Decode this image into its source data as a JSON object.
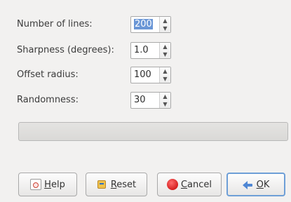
{
  "fields": [
    {
      "label": "Number of lines:",
      "value": "200",
      "selected": true
    },
    {
      "label": "Sharpness (degrees):",
      "value": "1.0",
      "selected": false
    },
    {
      "label": "Offset radius:",
      "value": "100",
      "selected": false
    },
    {
      "label": "Randomness:",
      "value": "30",
      "selected": false
    }
  ],
  "progress": {
    "fraction": 0
  },
  "buttons": {
    "help": {
      "mnemonic": "H",
      "rest": "elp"
    },
    "reset": {
      "mnemonic": "R",
      "rest": "eset"
    },
    "cancel": {
      "mnemonic": "C",
      "rest": "ancel"
    },
    "ok": {
      "mnemonic": "O",
      "rest": "K"
    }
  },
  "icons": {
    "help": "help-icon",
    "reset": "reset-icon",
    "cancel": "cancel-icon",
    "ok": "ok-arrow-icon",
    "spin_up": "chevron-up-icon",
    "spin_down": "chevron-down-icon"
  }
}
